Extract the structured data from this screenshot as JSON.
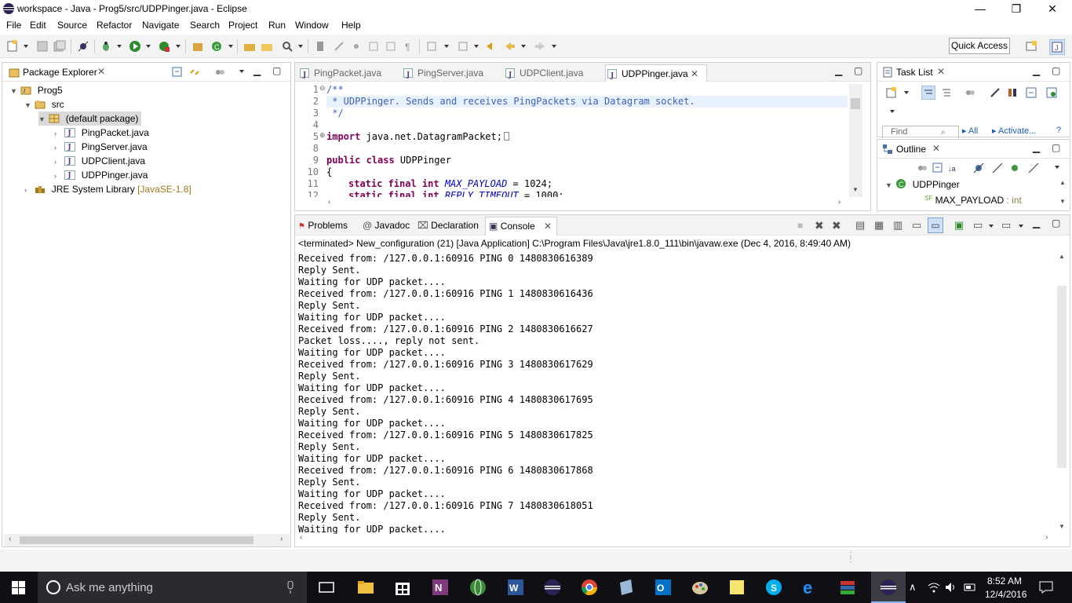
{
  "window": {
    "title": "workspace - Java - Prog5/src/UDPPinger.java - Eclipse",
    "controls": {
      "minimize": "—",
      "restore": "❐",
      "close": "✕"
    }
  },
  "menu": [
    "File",
    "Edit",
    "Source",
    "Refactor",
    "Navigate",
    "Search",
    "Project",
    "Run",
    "Window",
    "Help"
  ],
  "toolbar": {
    "quick_access": "Quick Access"
  },
  "package_explorer": {
    "title": "Package Explorer",
    "tree": {
      "project": "Prog5",
      "src": "src",
      "package": "(default package)",
      "files": [
        "PingPacket.java",
        "PingServer.java",
        "UDPClient.java",
        "UDPPinger.java"
      ],
      "jre": "JRE System Library",
      "jre_version": "[JavaSE-1.8]"
    }
  },
  "editor": {
    "tabs": [
      "PingPacket.java",
      "PingServer.java",
      "UDPClient.java",
      "UDPPinger.java"
    ],
    "active_tab": "UDPPinger.java",
    "code": [
      {
        "num": "1",
        "text": "/**"
      },
      {
        "num": "2",
        "text": " * UDPPinger. Sends and receives PingPackets via Datagram socket."
      },
      {
        "num": "3",
        "text": " */"
      },
      {
        "num": "4",
        "text": ""
      },
      {
        "num": "5",
        "kw": "import",
        "text": " java.net.DatagramPacket;"
      },
      {
        "num": "8",
        "text": ""
      },
      {
        "num": "9",
        "kw": "public class",
        "text": " UDPPinger"
      },
      {
        "num": "10",
        "text": "{"
      },
      {
        "num": "11",
        "kw": "static final int",
        "const": "MAX_PAYLOAD",
        "text": " = 1024;"
      },
      {
        "num": "12",
        "kw": "static final int",
        "const": "REPLY_TIMEOUT",
        "text": " = 1000;"
      }
    ]
  },
  "task_list": {
    "title": "Task List",
    "find": "Find",
    "all": "All",
    "activate": "Activate..."
  },
  "outline": {
    "title": "Outline",
    "class": "UDPPinger",
    "field": "MAX_PAYLOAD",
    "field_type": ": int"
  },
  "bottom_tabs": [
    "Problems",
    "Javadoc",
    "Declaration",
    "Console"
  ],
  "console": {
    "header": "<terminated> New_configuration (21) [Java Application] C:\\Program Files\\Java\\jre1.8.0_111\\bin\\javaw.exe (Dec 4, 2016, 8:49:40 AM)",
    "lines": [
      "Received from: /127.0.0.1:60916 PING 0 1480830616389",
      "Reply Sent.",
      "Waiting for UDP packet....",
      "Received from: /127.0.0.1:60916 PING 1 1480830616436",
      "Reply Sent.",
      "Waiting for UDP packet....",
      "Received from: /127.0.0.1:60916 PING 2 1480830616627",
      "Packet loss...., reply not sent.",
      "Waiting for UDP packet....",
      "Received from: /127.0.0.1:60916 PING 3 1480830617629",
      "Reply Sent.",
      "Waiting for UDP packet....",
      "Received from: /127.0.0.1:60916 PING 4 1480830617695",
      "Reply Sent.",
      "Waiting for UDP packet....",
      "Received from: /127.0.0.1:60916 PING 5 1480830617825",
      "Reply Sent.",
      "Waiting for UDP packet....",
      "Received from: /127.0.0.1:60916 PING 6 1480830617868",
      "Reply Sent.",
      "Waiting for UDP packet....",
      "Received from: /127.0.0.1:60916 PING 7 1480830618051",
      "Reply Sent.",
      "Waiting for UDP packet...."
    ]
  },
  "taskbar": {
    "search_placeholder": "Ask me anything",
    "time": "8:52 AM",
    "date": "12/4/2016"
  },
  "colors": {
    "accent": "#3f5fbf",
    "keyword": "#7f0055",
    "taskbar": "#101014"
  }
}
